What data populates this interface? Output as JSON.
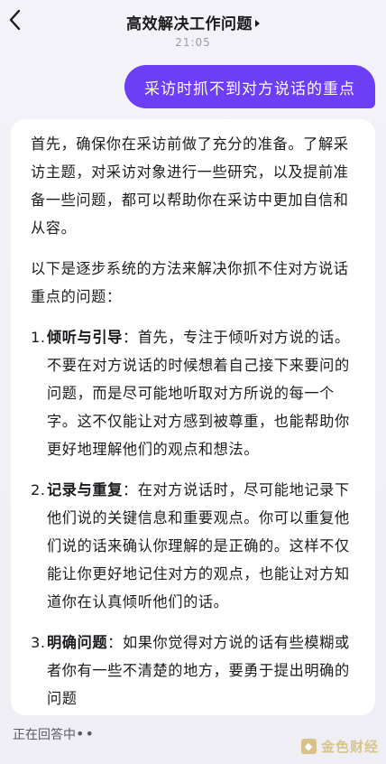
{
  "header": {
    "title": "高效解决工作问题",
    "back_icon": "chevron-left-icon",
    "title_icon": "caret-right-icon"
  },
  "timestamp": "21:05",
  "user_message": "采访时抓不到对方说话的重点",
  "answer": {
    "intro": "首先，确保你在采访前做了充分的准备。了解采访主题，对采访对象进行一些研究，以及提前准备一些问题，都可以帮助你在采访中更加自信和从容。",
    "lead": "以下是逐步系统的方法来解决你抓不住对方说话重点的问题：",
    "items": [
      {
        "number": "1.",
        "title": "倾听与引导",
        "body": "：首先，专注于倾听对方说的话。不要在对方说话的时候想着自己接下来要问的问题，而是尽可能地听取对方所说的每一个字。这不仅能让对方感到被尊重，也能帮助你更好地理解他们的观点和想法。"
      },
      {
        "number": "2.",
        "title": "记录与重复",
        "body": "：在对方说话时，尽可能地记录下他们说的关键信息和重要观点。你可以重复他们说的话来确认你理解的是正确的。这样不仅能让你更好地记住对方的观点，也能让对方知道你在认真倾听他们的话。"
      },
      {
        "number": "3.",
        "title": "明确问题",
        "body": "：如果你觉得对方说的话有些模糊或者你有一些不清楚的地方，要勇于提出明确的问题"
      }
    ]
  },
  "status": {
    "text": "正在回答中",
    "dots": "••"
  },
  "watermark": {
    "text": "金色财经"
  },
  "colors": {
    "accent": "#6c3ef6",
    "background": "#f1f0f6",
    "card": "#ffffff"
  }
}
